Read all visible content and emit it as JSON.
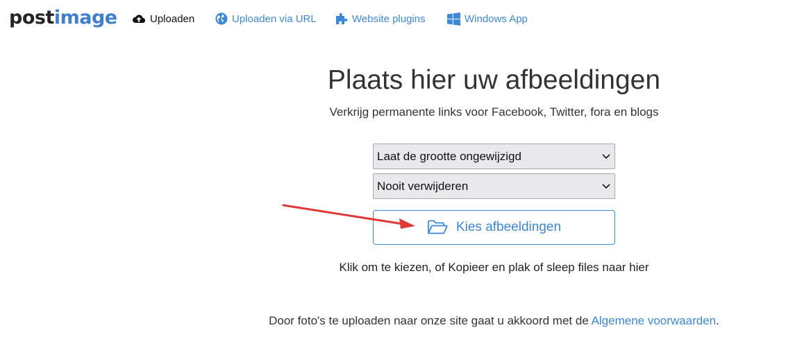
{
  "colors": {
    "link": "#3a88d8",
    "text": "#333333",
    "logo_dark": "#252525",
    "logo_accent": "#3f7fcf",
    "annotation_arrow": "#e03a36"
  },
  "header": {
    "logo": {
      "part1": "post",
      "part2": "image"
    },
    "nav": [
      {
        "label": "Uploaden",
        "icon": "cloud-upload-icon",
        "active": true
      },
      {
        "label": "Uploaden via URL",
        "icon": "globe-icon",
        "active": false
      },
      {
        "label": "Website plugins",
        "icon": "puzzle-icon",
        "active": false
      },
      {
        "label": "Windows App",
        "icon": "windows-icon",
        "active": false
      }
    ]
  },
  "main": {
    "title": "Plaats hier uw afbeeldingen",
    "subtitle": "Verkrijg permanente links voor Facebook, Twitter, fora en blogs",
    "resize_select": {
      "value": "Laat de grootte ongewijzigd",
      "icon": "chevron-down-icon"
    },
    "expire_select": {
      "value": "Nooit verwijderen",
      "icon": "chevron-down-icon"
    },
    "choose_button": {
      "label": "Kies afbeeldingen",
      "icon": "folder-open-icon"
    },
    "hint": "Klik om te kiezen, of Kopieer en plak of sleep files naar hier",
    "terms": {
      "text": "Door foto's te uploaden naar onze site gaat u akkoord met de ",
      "link": "Algemene voorwaarden",
      "end": "."
    }
  },
  "annotation": {
    "type": "arrow",
    "points_to": "choose_button"
  }
}
